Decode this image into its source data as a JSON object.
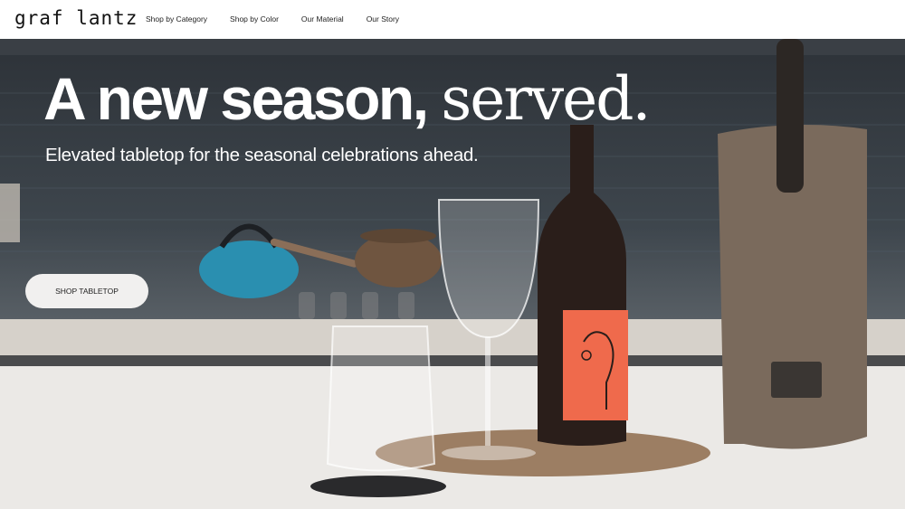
{
  "header": {
    "logo": "graf lantz",
    "nav": [
      {
        "label": "Shop by Category"
      },
      {
        "label": "Shop by Color"
      },
      {
        "label": "Our Material"
      },
      {
        "label": "Our Story"
      }
    ]
  },
  "hero": {
    "headline_part1": "A new season,",
    "headline_part2": "served.",
    "subheadline": "Elevated tabletop for the seasonal celebrations ahead.",
    "cta_label": "SHOP TABLETOP"
  }
}
